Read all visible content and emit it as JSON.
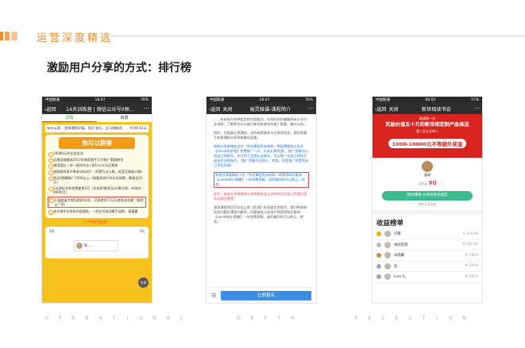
{
  "header": {
    "title": "运营深度精选",
    "subtitle": "激励用户分享的方式：排行榜"
  },
  "footer": {
    "words": [
      "OPERATIONAL",
      "DEPTH",
      "SELECTION"
    ]
  },
  "phone1": {
    "status_left": "中国联通",
    "status_time": "18:47",
    "status_right": "76%",
    "back": "返回",
    "title": "14天训练营 | 微信公众号0预...",
    "tabs": [
      "详情",
      "目录"
    ],
    "top_left": "有什么我… 我带课程详情，知识·执行，立马就能用",
    "top_right": "¥199.01元",
    "card_title": "你可以获得",
    "benefits": [
      "10000元作业奖金池",
      "运营深度精选2017年独家超牛万字推广套路教学",
      "课用团队一对一指导作业+执行公众号运营课",
      "按照案例用户奉参分析执行（积累行业人脉，拓宽互联网人脉）",
      "保证0预算推广1000以上（接要求执行作业及效果，最高达20元）",
      "3太原标书条免费使用1月（任务发/群发及/众筹分销，市场价：9000/月）",
      "公菜邀请力排行榜前10名，可获得领下1天1夜密训名额（限北上广深）",
      "本次课作业所有内容服务，一经支付成功概不退款，请慎重"
    ],
    "rank_title": "人气排行名单：",
    "rank_row_left": "1名",
    "rank_row_right": "3元",
    "avatar_name": "陈……",
    "fab": "分享"
  },
  "phone2": {
    "status_left": "中国联通",
    "status_time": "18:47",
    "status_right": "76%",
    "back": "返回",
    "close": "关闭",
    "title": "易灵微课-课程简介",
    "paragraphs": [
      "……所有账号各种类型的内容能力，在短时间内掌握所有公号行业现状，了解到为什么能力能到有增长的推广套路，赚什么钱。",
      "同时，为鼓励分享课程，对所有愿意参与分享的同学，我们将基于有效课程分享获取最佳回报。",
      "有效分享就像前五名（完成课程并未退款）将获得微信公众号【cacob的学院】免费推广一次，头条文章资源）。推广资格可以给自己的账号，也可用于品牌企业账号。可以推广给自己的账号或合作方的账号。（推广资格可以转让，转卖。但是推广的是您自己不实资源）",
      "有效分享就像前十名（完成课程并未退款）将获得知识星球【cacob的小密圈】一年免费资格。该资格同样可以转让，转卖。",
      "此外，有效分享就像前十名将有机会认识其他同学加入到我们团队的顾问课程。",
      "基本课程项目可在右上角【交流】板块留言交提问，我们将选取优质问题在课堂内解答，问题被选入的用户将获得知识星球【cacob的小密圈】一年免费资格，该资格同样可以转让，转卖。"
    ],
    "menu_icon": "☰",
    "signup": "立即报名"
  },
  "phone3": {
    "status_left": "中国联通",
    "status_time": "06:05",
    "status_right": "57%",
    "back": "返回",
    "close": "关闭",
    "title": "新世相读书会",
    "banner_top": "邀请第一名",
    "banner_l1": "奖励价值五十万的新世相定制产品推送",
    "banner_l2": "第二至五名每人",
    "banner_l3": "1000-10000元不等额外奖金",
    "user_name": "姜颖",
    "earn_label": "总收益",
    "earn_value": "¥0",
    "share_btn": "继续赚钱 分享给更多朋友",
    "link": "我的分享收益",
    "rank_title": "收益榜单",
    "ranking": [
      {
        "name": "叮嘟",
        "amount": "¥ 150.46",
        "medal": "#f5b400"
      },
      {
        "name": "闹闹花落",
        "amount": "¥ 142.56",
        "medal": "#b9b9c8"
      },
      {
        "name": "米酒藏",
        "amount": "¥ 139.6",
        "medal": "#d08a45"
      },
      {
        "name": "彭",
        "amount": "¥ 139.6",
        "medal": "#9aa7bd"
      },
      {
        "name": "Lam.X_",
        "amount": "¥ 139.6",
        "medal": "#9aa7bd"
      }
    ]
  }
}
